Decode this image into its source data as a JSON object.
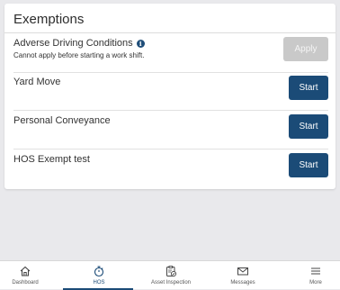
{
  "card": {
    "title": "Exemptions",
    "rows": [
      {
        "label": "Adverse Driving Conditions",
        "sublabel": "Cannot apply before starting a work shift.",
        "button": "Apply",
        "button_state": "disabled"
      },
      {
        "label": "Yard Move",
        "button": "Start",
        "button_state": "enabled"
      },
      {
        "label": "Personal Conveyance",
        "button": "Start",
        "button_state": "enabled"
      },
      {
        "label": "HOS Exempt test",
        "button": "Start",
        "button_state": "enabled"
      }
    ]
  },
  "bottom_nav": {
    "items": [
      {
        "label": "Dashboard",
        "icon": "home-icon"
      },
      {
        "label": "HOS",
        "icon": "stopwatch-icon",
        "active": true
      },
      {
        "label": "Asset Inspection",
        "icon": "clipboard-check-icon"
      },
      {
        "label": "Messages",
        "icon": "envelope-icon"
      },
      {
        "label": "More",
        "icon": "menu-icon"
      }
    ]
  },
  "colors": {
    "primary": "#1b4b77",
    "disabled_button": "#c9c9c9",
    "background": "#e9e9ec"
  }
}
